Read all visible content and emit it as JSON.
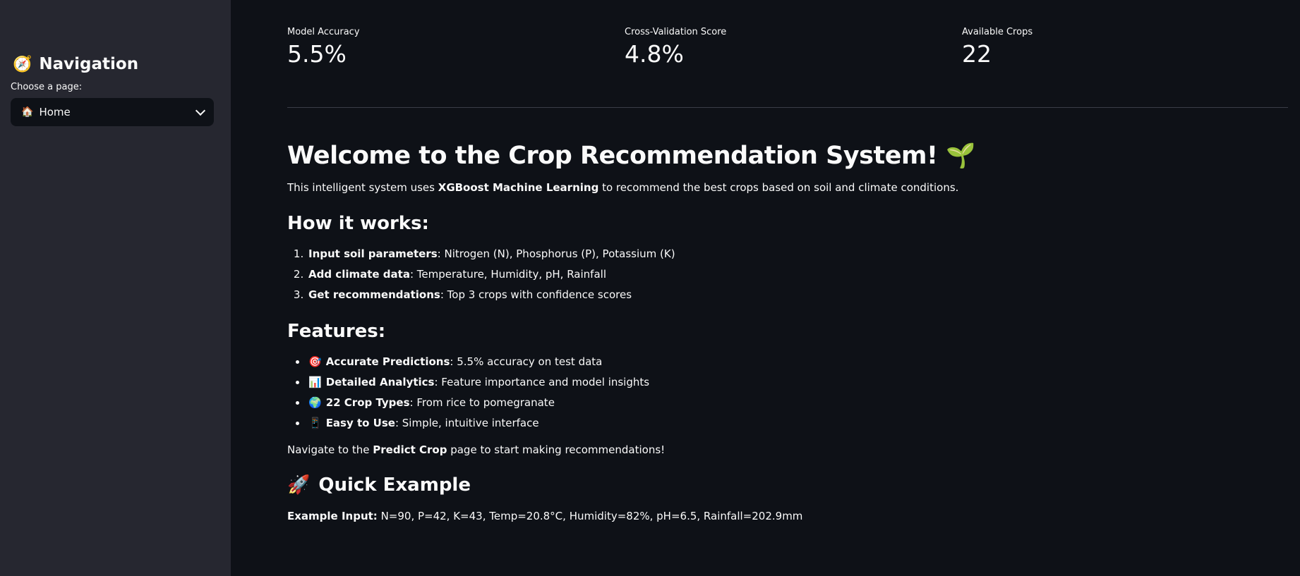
{
  "sidebar": {
    "title": "Navigation",
    "title_icon": "compass-icon",
    "select_label": "Choose a page:",
    "select_value": "Home",
    "select_icon": "house-icon"
  },
  "metrics": [
    {
      "label": "Model Accuracy",
      "value": "5.5%"
    },
    {
      "label": "Cross-Validation Score",
      "value": "4.8%"
    },
    {
      "label": "Available Crops",
      "value": "22"
    }
  ],
  "welcome": {
    "title": "Welcome to the Crop Recommendation System!",
    "title_icon": "seedling-icon",
    "intro_pre": "This intelligent system uses ",
    "intro_bold": "XGBoost Machine Learning",
    "intro_post": " to recommend the best crops based on soil and climate conditions."
  },
  "how_it_works": {
    "heading": "How it works:",
    "steps": [
      {
        "bold": "Input soil parameters",
        "text": ": Nitrogen (N), Phosphorus (P), Potassium (K)"
      },
      {
        "bold": "Add climate data",
        "text": ": Temperature, Humidity, pH, Rainfall"
      },
      {
        "bold": "Get recommendations",
        "text": ": Top 3 crops with confidence scores"
      }
    ]
  },
  "features": {
    "heading": "Features:",
    "items": [
      {
        "icon": "target-icon",
        "glyph": "🎯",
        "bold": "Accurate Predictions",
        "text": ": 5.5% accuracy on test data"
      },
      {
        "icon": "chart-icon",
        "glyph": "📊",
        "bold": "Detailed Analytics",
        "text": ": Feature importance and model insights"
      },
      {
        "icon": "globe-icon",
        "glyph": "🌍",
        "bold": "22 Crop Types",
        "text": ": From rice to pomegranate"
      },
      {
        "icon": "phone-icon",
        "glyph": "📱",
        "bold": "Easy to Use",
        "text": ": Simple, intuitive interface"
      }
    ]
  },
  "navigate": {
    "pre": "Navigate to the ",
    "bold": "Predict Crop",
    "post": " page to start making recommendations!"
  },
  "quick_example": {
    "heading": "Quick Example",
    "icon": "rocket-icon",
    "input_label": "Example Input:",
    "input_text": " N=90, P=42, K=43, Temp=20.8°C, Humidity=82%, pH=6.5, Rainfall=202.9mm"
  }
}
